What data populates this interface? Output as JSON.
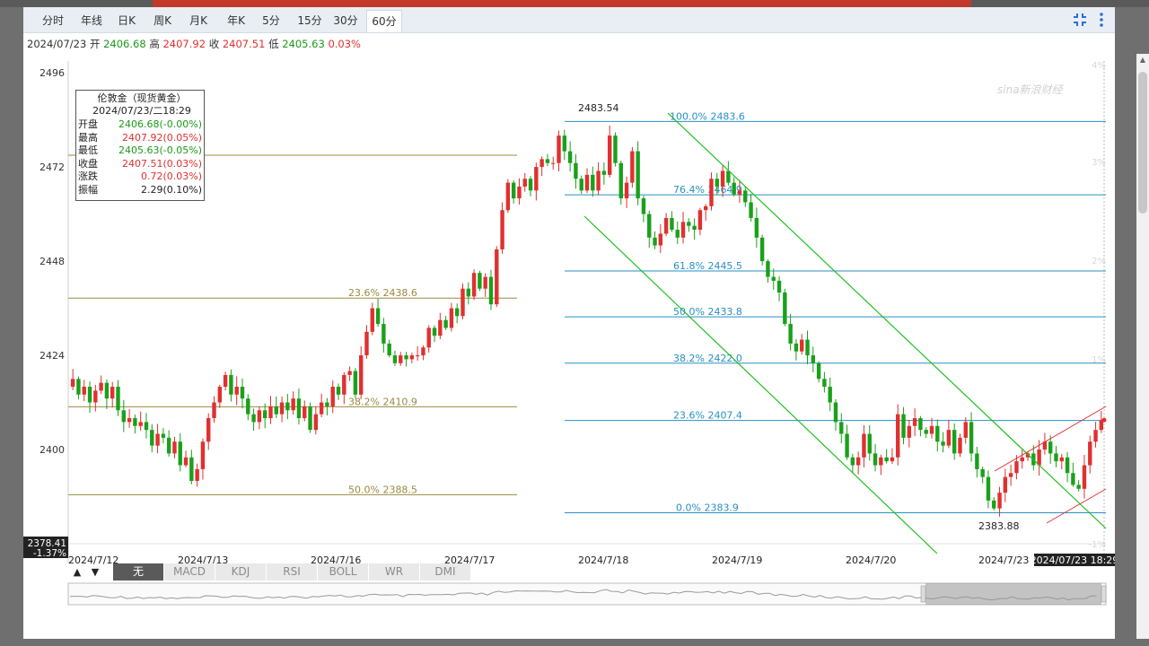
{
  "tabs": [
    {
      "label": "分时"
    },
    {
      "label": "年线"
    },
    {
      "label": "日K"
    },
    {
      "label": "周K"
    },
    {
      "label": "月K"
    },
    {
      "label": "年K"
    },
    {
      "label": "5分"
    },
    {
      "label": "15分"
    },
    {
      "label": "30分"
    },
    {
      "label": "60分",
      "active": true
    }
  ],
  "info_line": {
    "date": "2024/07/23",
    "open_label": "开",
    "open": "2406.68",
    "high_label": "高",
    "high": "2407.92",
    "close_label": "收",
    "close": "2407.51",
    "low_label": "低",
    "low": "2405.63",
    "change": "0.03%"
  },
  "tooltip": {
    "title": "伦敦金（现货黄金）",
    "datetime": "2024/07/23/二18:29",
    "rows": [
      {
        "label": "开盘",
        "value": "2406.68(-0.00%)",
        "color": "#1a9a1a"
      },
      {
        "label": "最高",
        "value": "2407.92(0.05%)",
        "color": "#e03030"
      },
      {
        "label": "最低",
        "value": "2405.63(-0.05%)",
        "color": "#1a9a1a"
      },
      {
        "label": "收盘",
        "value": "2407.51(0.03%)",
        "color": "#e03030"
      },
      {
        "label": "涨跌",
        "value": "0.72(0.03%)",
        "color": "#e03030"
      },
      {
        "label": "振幅",
        "value": "2.29(0.10%)",
        "color": "#222222"
      }
    ]
  },
  "indicators": [
    {
      "label": "无",
      "active": true
    },
    {
      "label": "MACD"
    },
    {
      "label": "KDJ"
    },
    {
      "label": "RSI"
    },
    {
      "label": "BOLL"
    },
    {
      "label": "WR"
    },
    {
      "label": "DMI"
    }
  ],
  "arrows": [
    "▲",
    "▼"
  ],
  "watermark": "sina新浪财经",
  "chart_data": {
    "type": "candlestick",
    "y_ticks": [
      2400,
      2424,
      2448,
      2472,
      2496
    ],
    "y_tick_labels": [
      "2400",
      "2424",
      "2448",
      "2472",
      "2496"
    ],
    "right_pct_labels": [
      "4%",
      "3%",
      "2%",
      "1%",
      "-1%"
    ],
    "x_tick_labels": [
      "2024/7/12",
      "2024/7/13",
      "2024/7/16",
      "2024/7/17",
      "2024/7/18",
      "2024/7/19",
      "2024/7/20",
      "2024/7/23"
    ],
    "x_axis_highlight": "2024/07/23 18:29",
    "y_axis_highlight": {
      "price": "2378.41",
      "pct": "-1.37%"
    },
    "current_price": 2407.5,
    "ylim": [
      2376,
      2499
    ],
    "annotations": [
      {
        "label": "2483.54",
        "value": 2483.54
      },
      {
        "label": "2383.88",
        "value": 2383.88
      }
    ],
    "fib_left": [
      {
        "label": "23.6% 2438.6",
        "value": 2438.6
      },
      {
        "label": "38.2% 2410.9",
        "value": 2410.9
      },
      {
        "label": "50.0% 2388.5",
        "value": 2388.5
      }
    ],
    "fib_left_top_value": 2475.0,
    "fib_right": [
      {
        "label": "100.0% 2483.6",
        "value": 2483.6
      },
      {
        "label": "76.4% 2464.9",
        "value": 2464.9
      },
      {
        "label": "61.8% 2445.5",
        "value": 2445.5
      },
      {
        "label": "50.0% 2433.8",
        "value": 2433.8
      },
      {
        "label": "38.2% 2422.0",
        "value": 2422.0
      },
      {
        "label": "23.6% 2407.4",
        "value": 2407.4
      },
      {
        "label": "0.0% 2383.9",
        "value": 2383.9
      }
    ],
    "closes": [
      2418,
      2414,
      2416,
      2412,
      2415,
      2417,
      2413,
      2416,
      2410,
      2407,
      2408,
      2406,
      2407,
      2405,
      2401,
      2404,
      2403,
      2399,
      2402,
      2396,
      2398,
      2392,
      2395,
      2402,
      2408,
      2412,
      2416,
      2419,
      2414,
      2416,
      2413,
      2409,
      2407,
      2410,
      2408,
      2411,
      2409,
      2412,
      2410,
      2413,
      2408,
      2411,
      2405,
      2409,
      2412,
      2411,
      2416,
      2414,
      2419,
      2420,
      2414,
      2424,
      2430,
      2436,
      2432,
      2427,
      2424,
      2422,
      2424,
      2423,
      2424,
      2424,
      2426,
      2431,
      2429,
      2433,
      2431,
      2436,
      2434,
      2441,
      2439,
      2445,
      2441,
      2444,
      2437,
      2451,
      2461,
      2468,
      2464,
      2467,
      2469,
      2466,
      2472,
      2474,
      2473,
      2473,
      2480,
      2476,
      2473,
      2469,
      2466,
      2470,
      2466,
      2471,
      2470,
      2480,
      2473,
      2464,
      2468,
      2476,
      2464,
      2460,
      2454,
      2452,
      2455,
      2459,
      2456,
      2454,
      2458,
      2457,
      2456,
      2461,
      2462,
      2469,
      2467,
      2471,
      2468,
      2465,
      2466,
      2463,
      2459,
      2454,
      2448,
      2444,
      2443,
      2440,
      2432,
      2427,
      2425,
      2428,
      2424,
      2422,
      2418,
      2416,
      2412,
      2407,
      2404,
      2398,
      2396,
      2398,
      2404,
      2399,
      2396,
      2398,
      2397,
      2398,
      2409,
      2403,
      2406,
      2408,
      2405,
      2404,
      2406,
      2402,
      2401,
      2405,
      2399,
      2403,
      2407,
      2399,
      2395,
      2393,
      2387,
      2385,
      2389,
      2393,
      2394,
      2397,
      2398,
      2399,
      2396,
      2400,
      2402,
      2399,
      2397,
      2398,
      2394,
      2391,
      2390,
      2396,
      2402,
      2405,
      2407.5
    ],
    "dates_hint": "hourly candles from 2024/7/12 to 2024/07/23 18:29"
  }
}
